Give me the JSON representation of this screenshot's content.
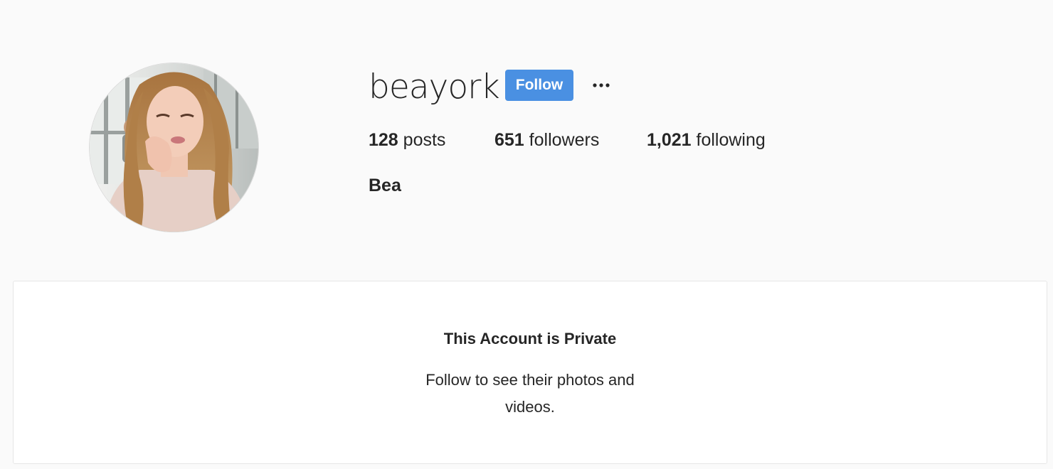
{
  "profile": {
    "username": "beayork",
    "follow_label": "Follow",
    "more_icon": "ellipsis-icon",
    "full_name": "Bea",
    "avatar_alt": "profile-photo"
  },
  "stats": {
    "posts_count": "128",
    "posts_label": "posts",
    "followers_count": "651",
    "followers_label": "followers",
    "following_count": "1,021",
    "following_label": "following"
  },
  "private_notice": {
    "title": "This Account is Private",
    "message": "Follow to see their photos and videos."
  },
  "colors": {
    "background": "#fafafa",
    "accent": "#4a90e2",
    "text": "#262626",
    "card": "#ffffff",
    "border": "#e6e6e6"
  }
}
